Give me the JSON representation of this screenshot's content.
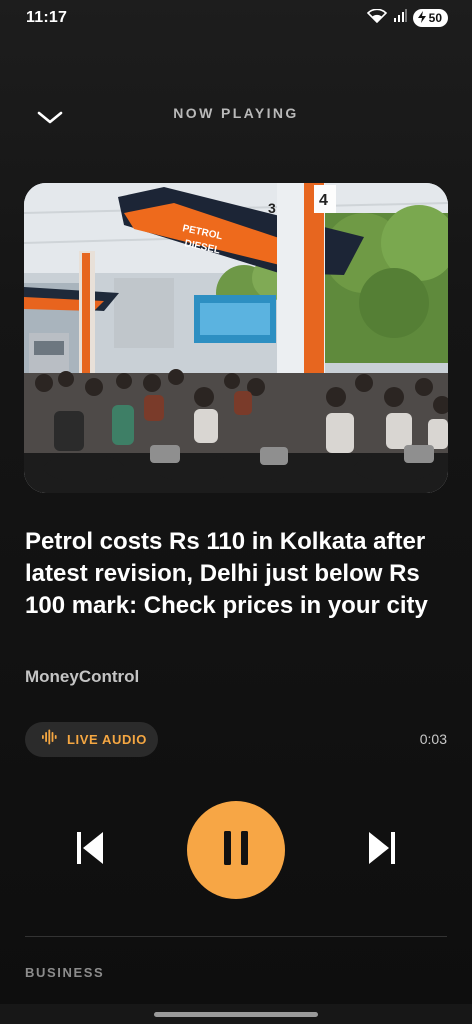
{
  "status_bar": {
    "time": "11:17",
    "battery": "50"
  },
  "header": {
    "title": "NOW PLAYING"
  },
  "artwork": {
    "canopy_text_line1": "PETROL",
    "canopy_text_line2": "DIESEL",
    "pump_number_left": "3",
    "pump_number_right": "4"
  },
  "article": {
    "headline": "Petrol costs Rs 110 in Kolkata after latest revision, Delhi just below Rs 100 mark: Check prices in your city",
    "source": "MoneyControl"
  },
  "player": {
    "live_label": "LIVE AUDIO",
    "elapsed": "0:03",
    "accent_color": "#f7a645"
  },
  "footer": {
    "category": "BUSINESS"
  }
}
